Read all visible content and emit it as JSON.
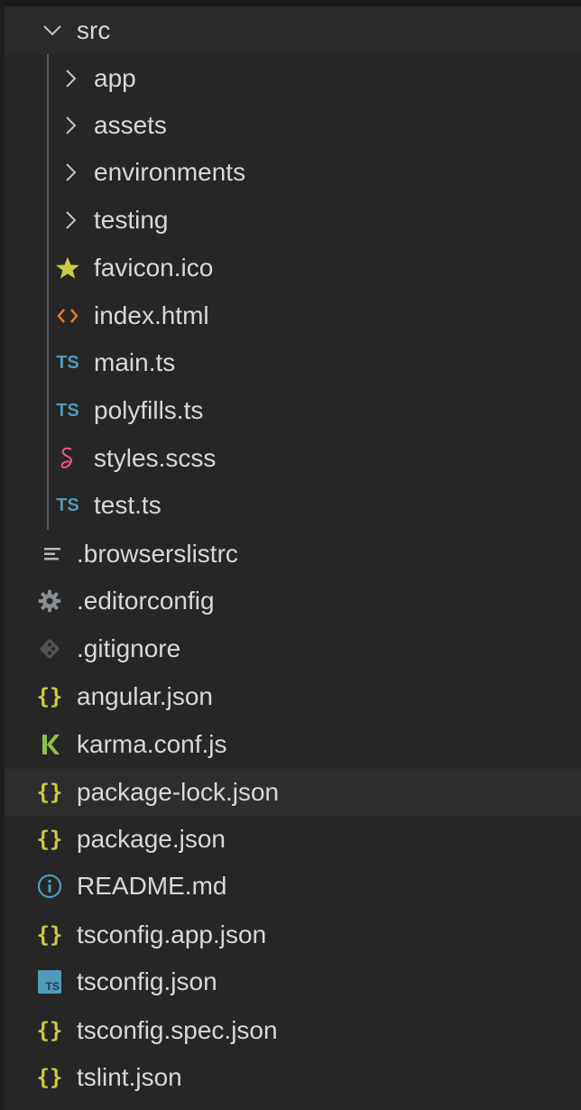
{
  "colors": {
    "background": "#262626",
    "text": "#d8d8d8",
    "hover_row": "#2c2d2d",
    "star_icon": "#cbcb41",
    "html_icon": "#e37933",
    "ts_icon": "#519aba",
    "sass_icon": "#f55385",
    "json_icon": "#cbcb41",
    "karma_icon": "#8dc149",
    "info_icon": "#519aba",
    "gray_icon": "#8a8f94"
  },
  "tree": {
    "root_folder": {
      "label": "src",
      "icon": "chevron-down-icon"
    },
    "src_children": [
      {
        "label": "app",
        "icon": "chevron-right-icon",
        "type": "folder"
      },
      {
        "label": "assets",
        "icon": "chevron-right-icon",
        "type": "folder"
      },
      {
        "label": "environments",
        "icon": "chevron-right-icon",
        "type": "folder"
      },
      {
        "label": "testing",
        "icon": "chevron-right-icon",
        "type": "folder"
      },
      {
        "label": "favicon.ico",
        "icon": "star-icon",
        "type": "file"
      },
      {
        "label": "index.html",
        "icon": "html-icon",
        "type": "file"
      },
      {
        "label": "main.ts",
        "icon": "typescript-icon",
        "icon_text": "TS",
        "type": "file"
      },
      {
        "label": "polyfills.ts",
        "icon": "typescript-icon",
        "icon_text": "TS",
        "type": "file"
      },
      {
        "label": "styles.scss",
        "icon": "sass-icon",
        "type": "file"
      },
      {
        "label": "test.ts",
        "icon": "typescript-icon",
        "icon_text": "TS",
        "type": "file"
      }
    ],
    "root_files": [
      {
        "label": ".browserslistrc",
        "icon": "lines-icon"
      },
      {
        "label": ".editorconfig",
        "icon": "gear-icon"
      },
      {
        "label": ".gitignore",
        "icon": "git-icon"
      },
      {
        "label": "angular.json",
        "icon": "json-icon",
        "icon_text": "{}"
      },
      {
        "label": "karma.conf.js",
        "icon": "karma-icon"
      },
      {
        "label": "package-lock.json",
        "icon": "json-icon",
        "icon_text": "{}",
        "hovered": true
      },
      {
        "label": "package.json",
        "icon": "json-icon",
        "icon_text": "{}"
      },
      {
        "label": "README.md",
        "icon": "info-icon"
      },
      {
        "label": "tsconfig.app.json",
        "icon": "json-icon",
        "icon_text": "{}"
      },
      {
        "label": "tsconfig.json",
        "icon": "tsconfig-icon",
        "icon_text": "TS"
      },
      {
        "label": "tsconfig.spec.json",
        "icon": "json-icon",
        "icon_text": "{}"
      },
      {
        "label": "tslint.json",
        "icon": "json-icon",
        "icon_text": "{}"
      }
    ]
  }
}
